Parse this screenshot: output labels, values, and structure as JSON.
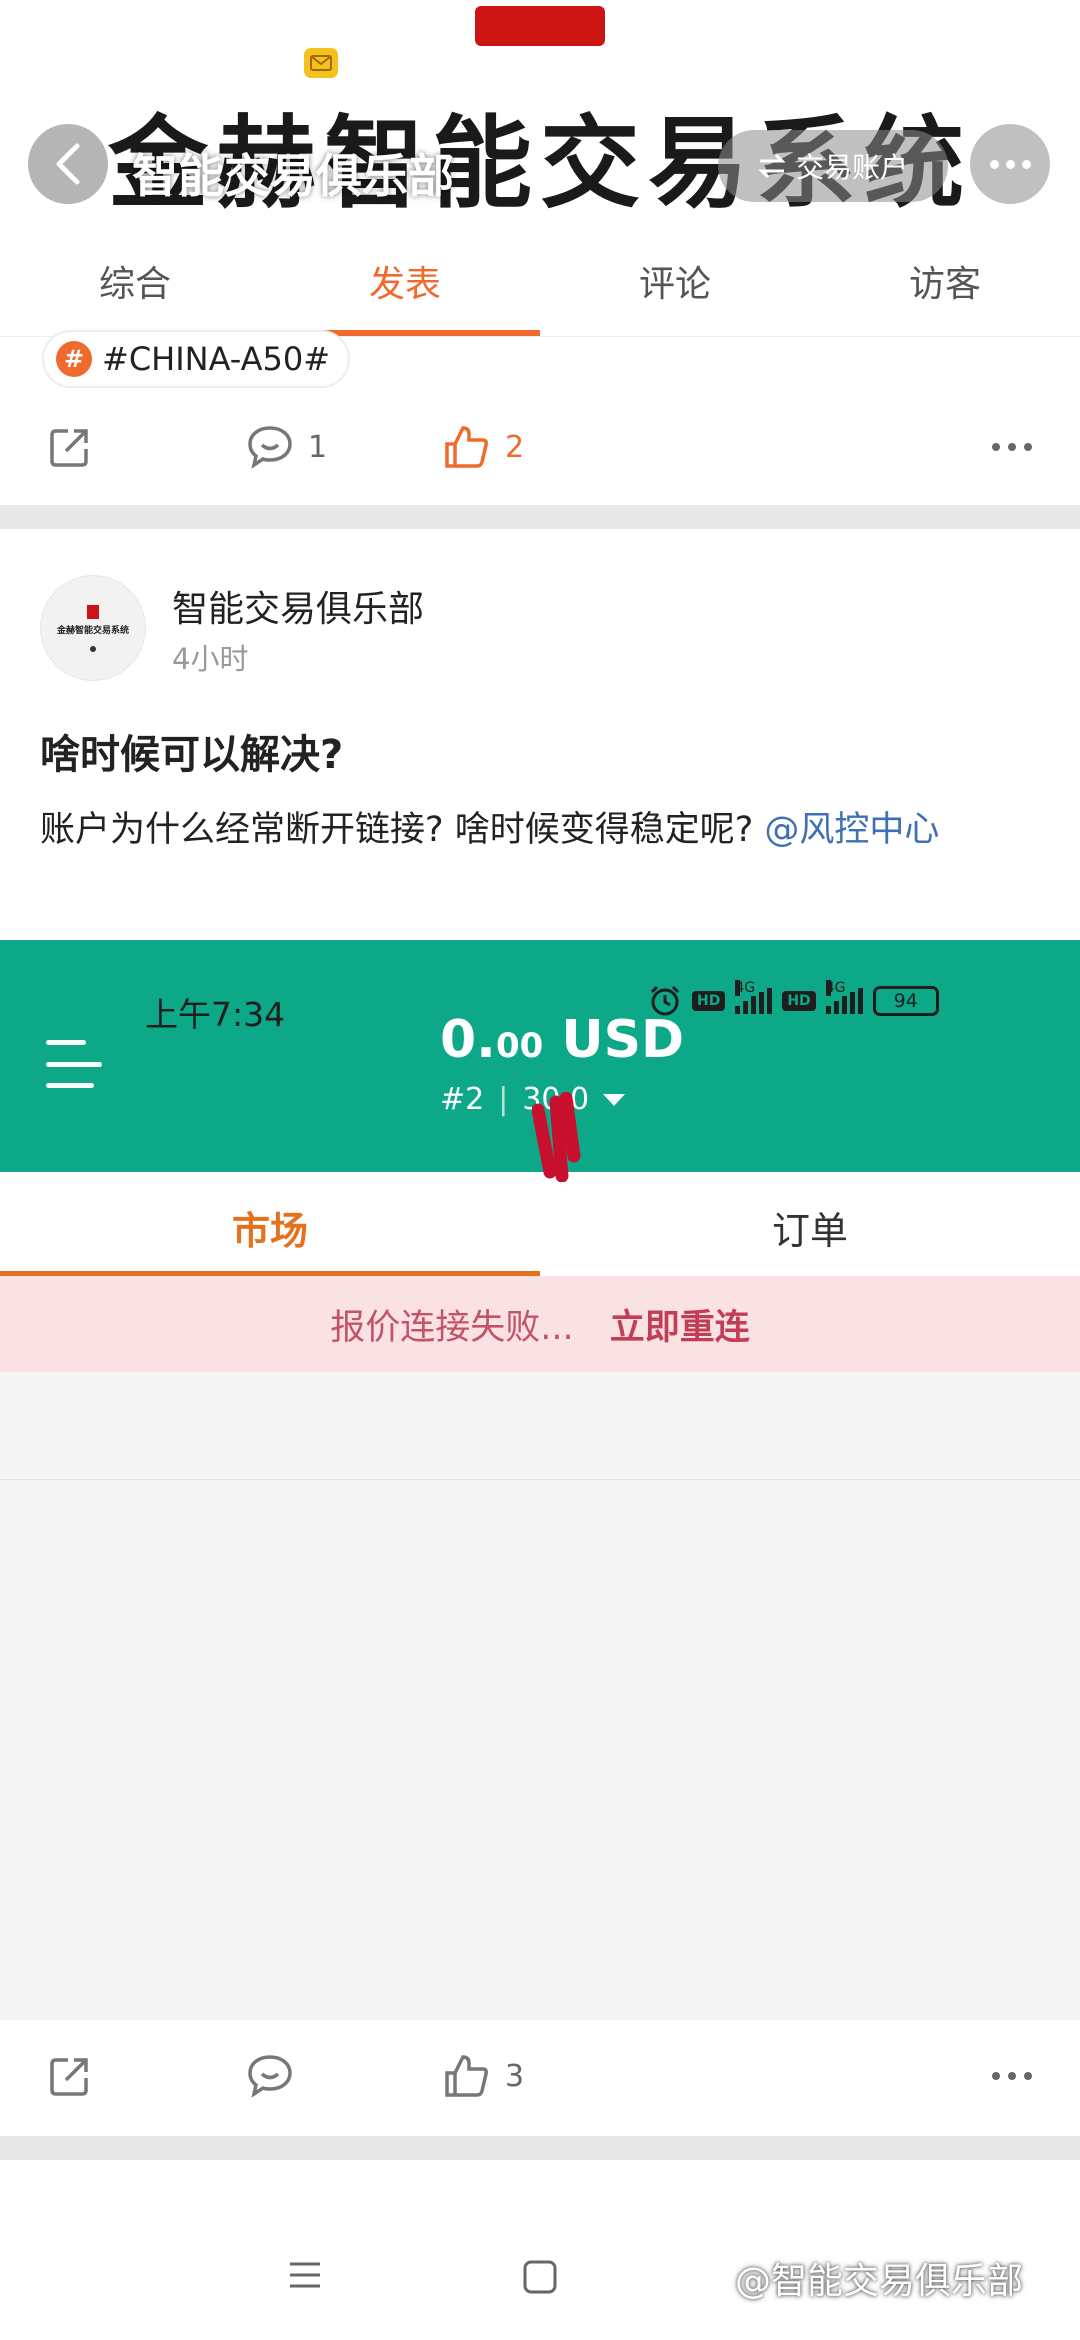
{
  "header": {
    "banner_text": "金赫智能交易系统",
    "nav_title": "智能交易俱乐部",
    "switch_label": "交易账户",
    "back_icon": "chevron-left-icon",
    "more_icon": "more-horizontal-icon",
    "mail_icon": "mail-icon"
  },
  "tabs": [
    {
      "label": "综合",
      "active": false
    },
    {
      "label": "发表",
      "active": true
    },
    {
      "label": "评论",
      "active": false
    },
    {
      "label": "访客",
      "active": false
    }
  ],
  "post1": {
    "hashtag": "#CHINA-A50#",
    "hashtag_icon": "#",
    "comment_count": "1",
    "like_count": "2"
  },
  "post2": {
    "author": "智能交易俱乐部",
    "time": "4小时",
    "avatar_logo_text": "金赫智能交易系统",
    "title": "啥时候可以解决?",
    "body": "账户为什么经常断开链接? 啥时候变得稳定呢? ",
    "mention": "@风控中心",
    "like_count": "3"
  },
  "screenshot": {
    "status_time": "上午7:34",
    "signal_label": "4G",
    "hd_label": "HD",
    "battery": "94",
    "balance_int": "0.",
    "balance_dec": "00",
    "currency": "USD",
    "account_prefix": "#2",
    "account_rest": "30 0",
    "tabs": [
      {
        "label": "市场",
        "active": true
      },
      {
        "label": "订单",
        "active": false
      }
    ],
    "warning_text": "报价连接失败...",
    "warning_action": "立即重连"
  },
  "watermark": "@智能交易俱乐部",
  "colors": {
    "accent": "#ef6a2c",
    "app_green": "#0ca887",
    "mention_blue": "#3f6fb5",
    "warn_bg": "#f9e1e4"
  }
}
